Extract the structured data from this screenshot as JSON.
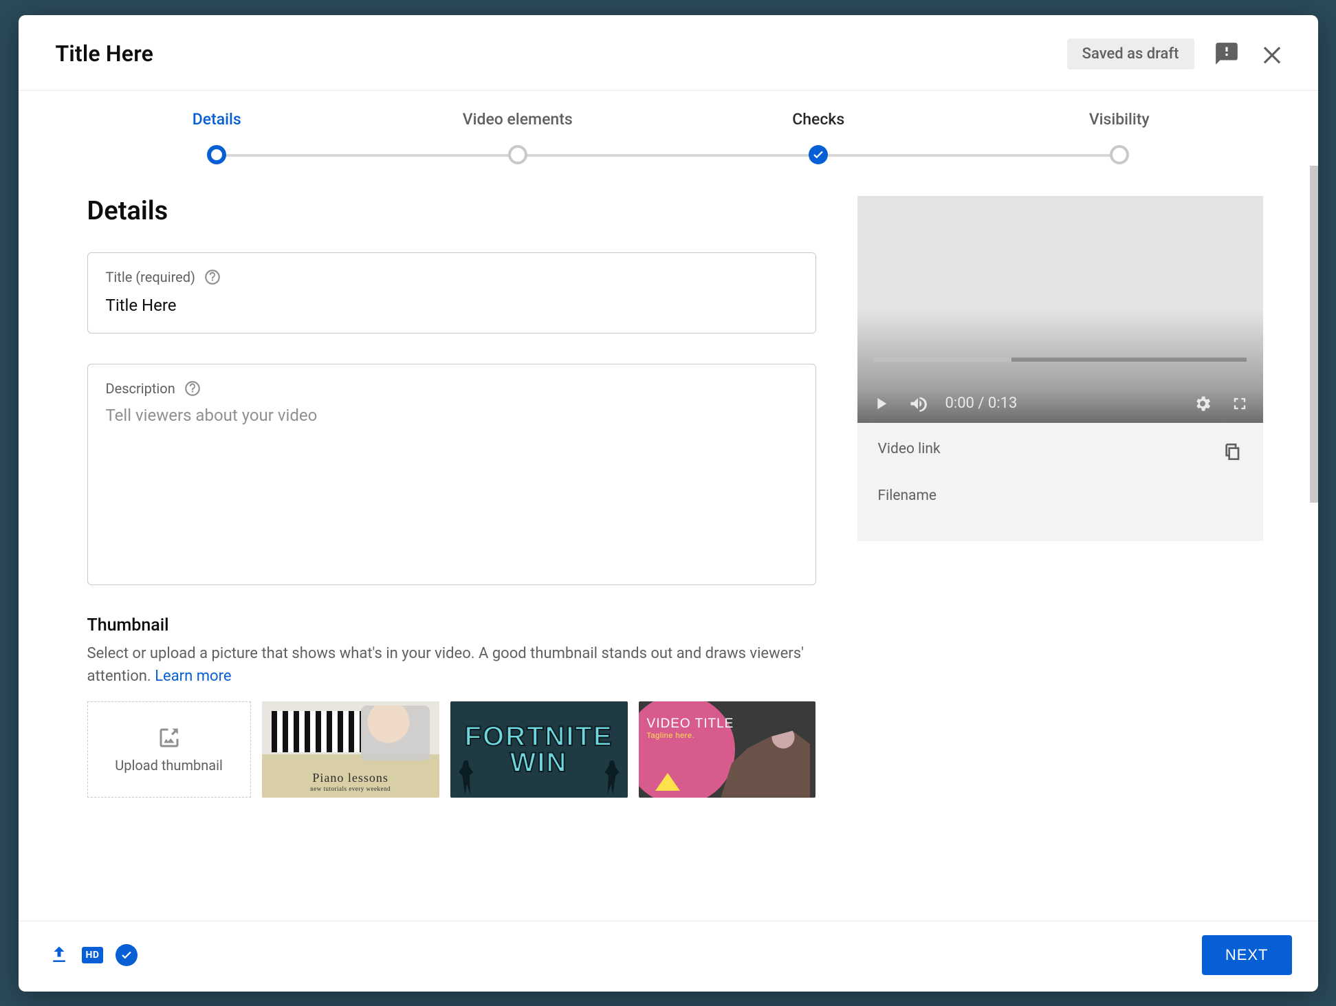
{
  "header": {
    "title": "Title Here",
    "saved_badge": "Saved as draft"
  },
  "stepper": {
    "steps": [
      {
        "label": "Details",
        "state": "active"
      },
      {
        "label": "Video elements",
        "state": "pending"
      },
      {
        "label": "Checks",
        "state": "done"
      },
      {
        "label": "Visibility",
        "state": "pending"
      }
    ]
  },
  "details": {
    "heading": "Details",
    "title_field_label": "Title (required)",
    "title_value": "Title Here",
    "description_label": "Description",
    "description_placeholder": "Tell viewers about your video"
  },
  "thumbnail": {
    "heading": "Thumbnail",
    "description": "Select or upload a picture that shows what's in your video. A good thumbnail stands out and draws viewers' attention. ",
    "learn_more": "Learn more",
    "upload_label": "Upload thumbnail",
    "items": [
      {
        "caption": "Piano lessons",
        "subcaption": "new tutorials every weekend"
      },
      {
        "line1": "FORTNITE",
        "line2": "WIN"
      },
      {
        "title": "VIDEO TITLE",
        "tagline": "Tagline here."
      }
    ]
  },
  "preview": {
    "time_display": "0:00 / 0:13",
    "video_link_label": "Video link",
    "filename_label": "Filename"
  },
  "footer": {
    "hd_label": "HD",
    "next_label": "NEXT"
  }
}
